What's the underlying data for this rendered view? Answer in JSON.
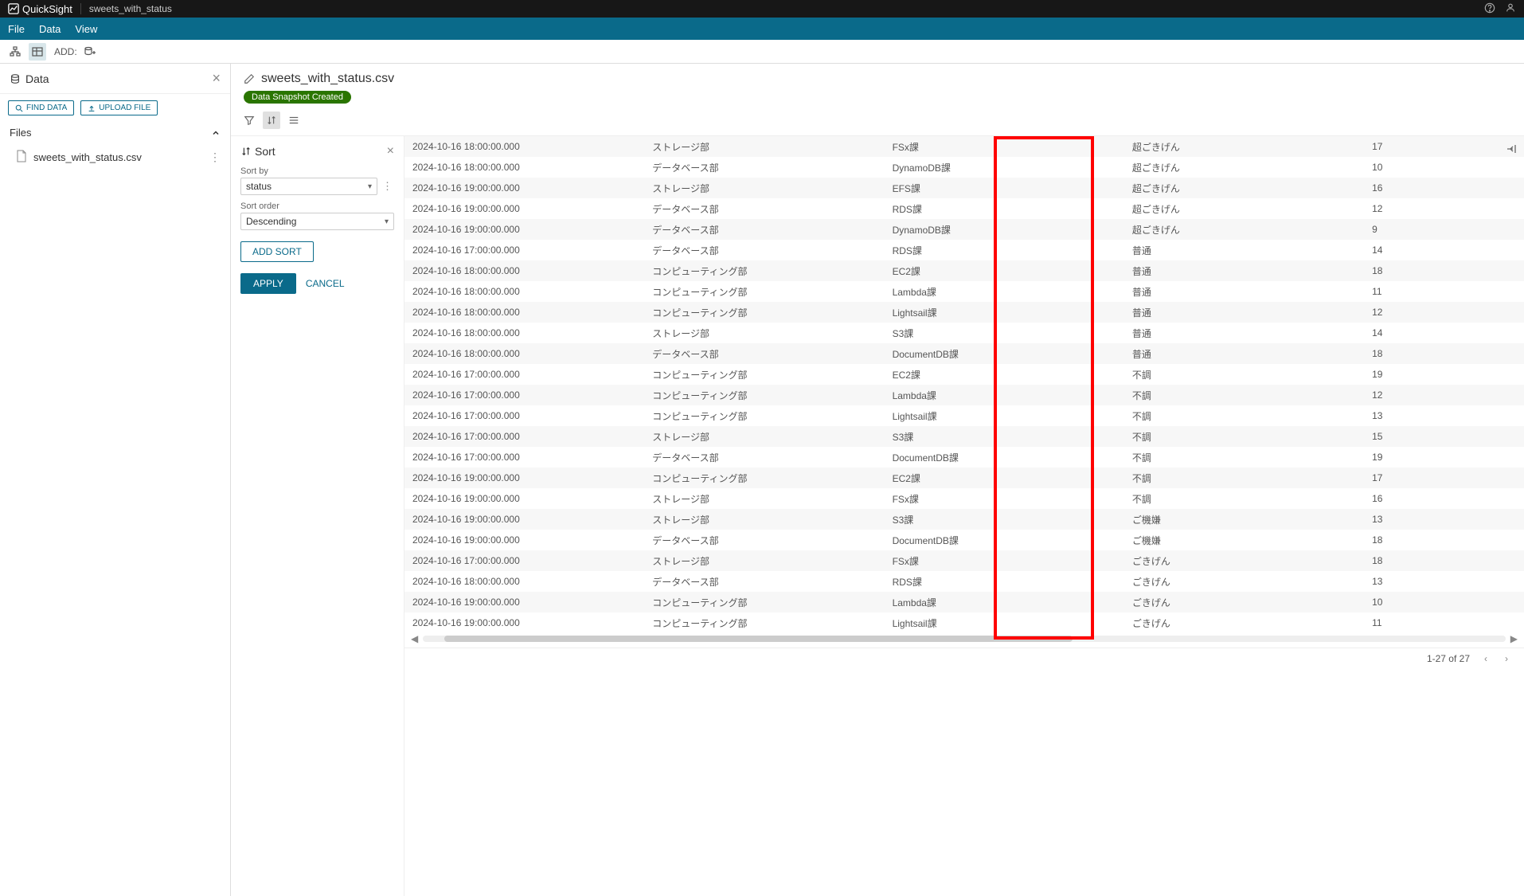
{
  "topbar": {
    "brand": "QuickSight",
    "title": "sweets_with_status"
  },
  "menubar": {
    "file": "File",
    "data": "Data",
    "view": "View"
  },
  "toolbar": {
    "add_label": "ADD:"
  },
  "sidebar": {
    "title": "Data",
    "find_data": "FIND DATA",
    "upload_file": "UPLOAD FILE",
    "section_files": "Files",
    "file_name": "sweets_with_status.csv"
  },
  "content": {
    "title": "sweets_with_status.csv",
    "snapshot_label": "Data Snapshot Created"
  },
  "sort_panel": {
    "title": "Sort",
    "sort_by_label": "Sort by",
    "sort_by_value": "status",
    "sort_order_label": "Sort order",
    "sort_order_value": "Descending",
    "add_sort": "ADD SORT",
    "apply": "APPLY",
    "cancel": "CANCEL"
  },
  "table": {
    "rows": [
      {
        "ts": "2024-10-16 18:00:00.000",
        "dept": "ストレージ部",
        "team": "FSx課",
        "status": "超ごきげん",
        "val": "17"
      },
      {
        "ts": "2024-10-16 18:00:00.000",
        "dept": "データベース部",
        "team": "DynamoDB課",
        "status": "超ごきげん",
        "val": "10"
      },
      {
        "ts": "2024-10-16 19:00:00.000",
        "dept": "ストレージ部",
        "team": "EFS課",
        "status": "超ごきげん",
        "val": "16"
      },
      {
        "ts": "2024-10-16 19:00:00.000",
        "dept": "データベース部",
        "team": "RDS課",
        "status": "超ごきげん",
        "val": "12"
      },
      {
        "ts": "2024-10-16 19:00:00.000",
        "dept": "データベース部",
        "team": "DynamoDB課",
        "status": "超ごきげん",
        "val": "9"
      },
      {
        "ts": "2024-10-16 17:00:00.000",
        "dept": "データベース部",
        "team": "RDS課",
        "status": "普通",
        "val": "14"
      },
      {
        "ts": "2024-10-16 18:00:00.000",
        "dept": "コンピューティング部",
        "team": "EC2課",
        "status": "普通",
        "val": "18"
      },
      {
        "ts": "2024-10-16 18:00:00.000",
        "dept": "コンピューティング部",
        "team": "Lambda課",
        "status": "普通",
        "val": "11"
      },
      {
        "ts": "2024-10-16 18:00:00.000",
        "dept": "コンピューティング部",
        "team": "Lightsail課",
        "status": "普通",
        "val": "12"
      },
      {
        "ts": "2024-10-16 18:00:00.000",
        "dept": "ストレージ部",
        "team": "S3課",
        "status": "普通",
        "val": "14"
      },
      {
        "ts": "2024-10-16 18:00:00.000",
        "dept": "データベース部",
        "team": "DocumentDB課",
        "status": "普通",
        "val": "18"
      },
      {
        "ts": "2024-10-16 17:00:00.000",
        "dept": "コンピューティング部",
        "team": "EC2課",
        "status": "不調",
        "val": "19"
      },
      {
        "ts": "2024-10-16 17:00:00.000",
        "dept": "コンピューティング部",
        "team": "Lambda課",
        "status": "不調",
        "val": "12"
      },
      {
        "ts": "2024-10-16 17:00:00.000",
        "dept": "コンピューティング部",
        "team": "Lightsail課",
        "status": "不調",
        "val": "13"
      },
      {
        "ts": "2024-10-16 17:00:00.000",
        "dept": "ストレージ部",
        "team": "S3課",
        "status": "不調",
        "val": "15"
      },
      {
        "ts": "2024-10-16 17:00:00.000",
        "dept": "データベース部",
        "team": "DocumentDB課",
        "status": "不調",
        "val": "19"
      },
      {
        "ts": "2024-10-16 19:00:00.000",
        "dept": "コンピューティング部",
        "team": "EC2課",
        "status": "不調",
        "val": "17"
      },
      {
        "ts": "2024-10-16 19:00:00.000",
        "dept": "ストレージ部",
        "team": "FSx課",
        "status": "不調",
        "val": "16"
      },
      {
        "ts": "2024-10-16 19:00:00.000",
        "dept": "ストレージ部",
        "team": "S3課",
        "status": "ご機嫌",
        "val": "13"
      },
      {
        "ts": "2024-10-16 19:00:00.000",
        "dept": "データベース部",
        "team": "DocumentDB課",
        "status": "ご機嫌",
        "val": "18"
      },
      {
        "ts": "2024-10-16 17:00:00.000",
        "dept": "ストレージ部",
        "team": "FSx課",
        "status": "ごきげん",
        "val": "18"
      },
      {
        "ts": "2024-10-16 18:00:00.000",
        "dept": "データベース部",
        "team": "RDS課",
        "status": "ごきげん",
        "val": "13"
      },
      {
        "ts": "2024-10-16 19:00:00.000",
        "dept": "コンピューティング部",
        "team": "Lambda課",
        "status": "ごきげん",
        "val": "10"
      },
      {
        "ts": "2024-10-16 19:00:00.000",
        "dept": "コンピューティング部",
        "team": "Lightsail課",
        "status": "ごきげん",
        "val": "11"
      }
    ]
  },
  "footer": {
    "range": "1-27 of 27"
  }
}
